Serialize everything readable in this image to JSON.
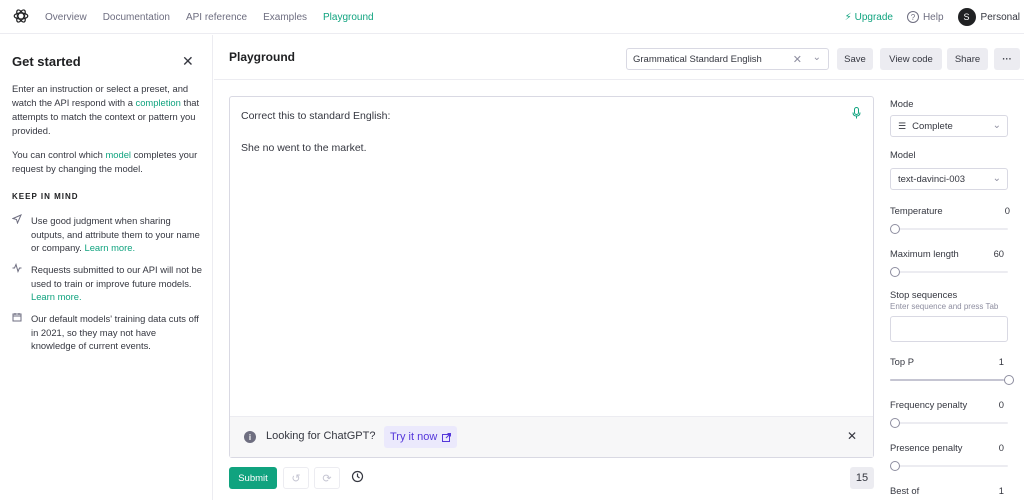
{
  "nav": {
    "links": [
      "Overview",
      "Documentation",
      "API reference",
      "Examples",
      "Playground"
    ],
    "upgrade": "Upgrade",
    "help": "Help",
    "avatar_initial": "S",
    "account": "Personal"
  },
  "left": {
    "title": "Get started",
    "p1_a": "Enter an instruction or select a preset, and watch the API respond with a ",
    "p1_link": "completion",
    "p1_b": " that attempts to match the context or pattern you provided.",
    "p2_a": "You can control which ",
    "p2_link": "model",
    "p2_b": " completes your request by changing the model.",
    "keep_in_mind": "KEEP IN MIND",
    "tips": [
      {
        "text": "Use good judgment when sharing outputs, and attribute them to your name or company. ",
        "link": "Learn more."
      },
      {
        "text": "Requests submitted to our API will not be used to train or improve future models. ",
        "link": "Learn more."
      },
      {
        "text": "Our default models' training data cuts off in 2021, so they may not have knowledge of current events.",
        "link": ""
      }
    ]
  },
  "header": {
    "title": "Playground",
    "preset": "Grammatical Standard English",
    "save": "Save",
    "view_code": "View code",
    "share": "Share",
    "more": "···"
  },
  "editor": {
    "line1": "Correct this to standard English:",
    "line2": "She no went to the market.",
    "banner_text": "Looking for ChatGPT?",
    "banner_link": "Try it now"
  },
  "footer": {
    "submit": "Submit",
    "token_count": "15"
  },
  "settings": {
    "mode_label": "Mode",
    "mode_value": "Complete",
    "model_label": "Model",
    "model_value": "text-davinci-003",
    "temperature_label": "Temperature",
    "temperature_value": "0",
    "max_length_label": "Maximum length",
    "max_length_value": "60",
    "stop_label": "Stop sequences",
    "stop_hint": "Enter sequence and press Tab",
    "top_p_label": "Top P",
    "top_p_value": "1",
    "freq_label": "Frequency penalty",
    "freq_value": "0",
    "presence_label": "Presence penalty",
    "presence_value": "0",
    "best_of_label": "Best of",
    "best_of_value": "1"
  },
  "colors": {
    "accent": "#10a37f",
    "chatgpt_badge_bg": "#ebe9fc",
    "chatgpt_badge_text": "#5436da"
  },
  "icons": {
    "logo": "openai-logo-icon",
    "upgrade": "lightning-icon",
    "help": "question-circle-icon",
    "close": "close-icon",
    "mic": "microphone-icon",
    "info": "info-icon",
    "external": "external-link-icon",
    "undo": "undo-icon",
    "regenerate": "regenerate-icon",
    "history": "history-icon",
    "send": "send-icon",
    "activity": "activity-icon",
    "calendar": "calendar-icon",
    "mode": "mode-complete-icon",
    "chevron": "chevron-down-icon"
  }
}
